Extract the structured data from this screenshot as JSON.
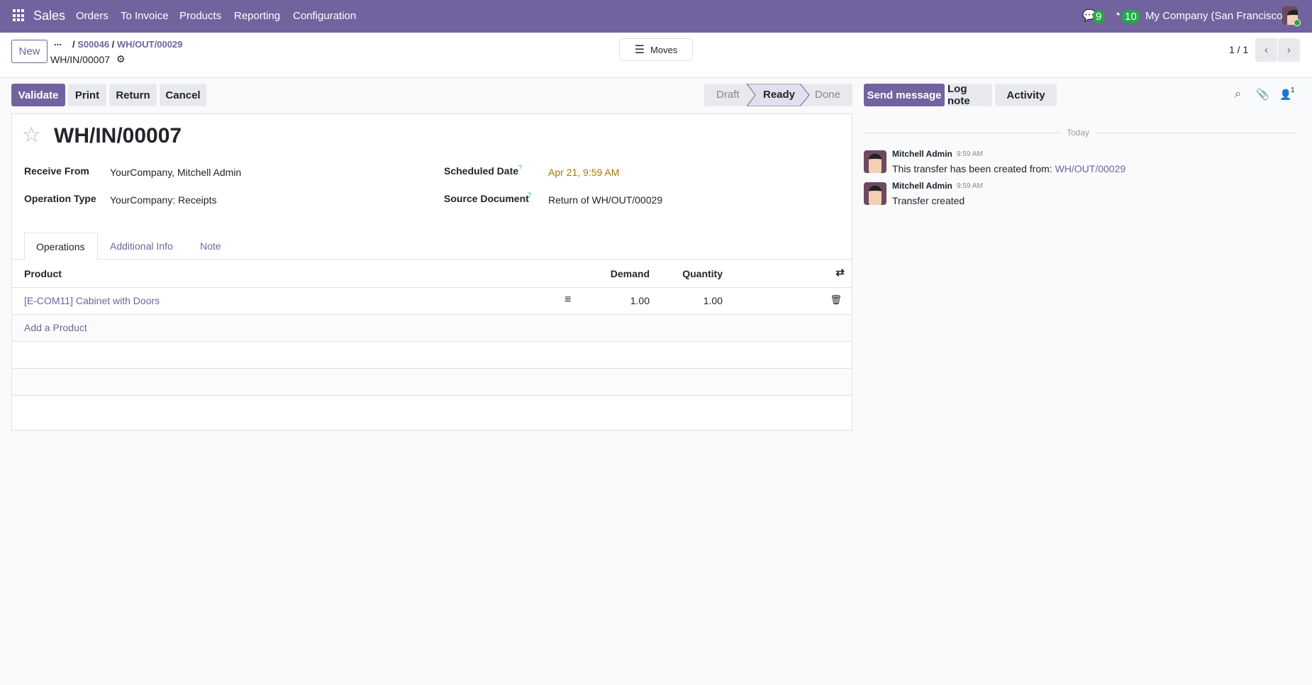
{
  "navbar": {
    "app": "Sales",
    "menu": [
      "Orders",
      "To Invoice",
      "Products",
      "Reporting",
      "Configuration"
    ],
    "messages_count": "9",
    "activities_count": "10",
    "company": "My Company (San Francisco)"
  },
  "control_panel": {
    "new_label": "New",
    "breadcrumb_more": "...",
    "breadcrumbs": [
      "S00046",
      "WH/OUT/00029"
    ],
    "current": "WH/IN/00007",
    "moves_label": "Moves",
    "pager": "1 / 1"
  },
  "actions": {
    "validate": "Validate",
    "print": "Print",
    "return": "Return",
    "cancel": "Cancel"
  },
  "status": {
    "steps": [
      "Draft",
      "Ready",
      "Done"
    ],
    "current": "Ready"
  },
  "form": {
    "title": "WH/IN/00007",
    "fields": [
      {
        "label": "Receive From",
        "value": "YourCompany, Mitchell Admin"
      },
      {
        "label": "Operation Type",
        "value": "YourCompany: Receipts"
      },
      {
        "label": "Scheduled Date",
        "value": "Apr 21, 9:59 AM",
        "help": "?"
      },
      {
        "label": "Source Document",
        "value": "Return of WH/OUT/00029",
        "help": "?"
      }
    ],
    "tabs": [
      "Operations",
      "Additional Info",
      "Note"
    ],
    "table": {
      "headers": [
        "Product",
        "Demand",
        "Quantity"
      ],
      "rows": [
        {
          "product": "[E-COM11] Cabinet with Doors",
          "demand": "1.00",
          "quantity": "1.00"
        }
      ],
      "add_label": "Add a Product"
    }
  },
  "chatter": {
    "send_message": "Send message",
    "log_note": "Log note",
    "activity": "Activity",
    "followers": "1",
    "date_sep": "Today",
    "messages": [
      {
        "author": "Mitchell Admin",
        "time": "9:59 AM",
        "text": "This transfer has been created from: ",
        "link": "WH/OUT/00029"
      },
      {
        "author": "Mitchell Admin",
        "time": "9:59 AM",
        "text": "Transfer created"
      }
    ]
  },
  "colors": {
    "brand": "#71639e",
    "date": "#a57a00"
  }
}
